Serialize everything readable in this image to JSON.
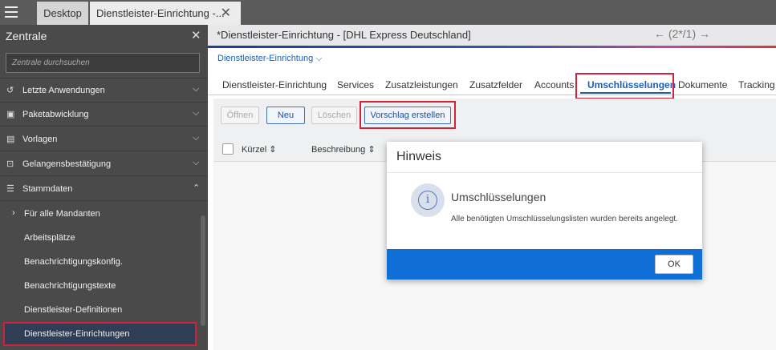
{
  "tabs": {
    "desktop": "Desktop",
    "active": "Dienstleister-Einrichtung -...",
    "close_icon": "✕"
  },
  "sidebar": {
    "title": "Zentrale",
    "search_placeholder": "Zentrale durchsuchen",
    "items": [
      {
        "label": "Letzte Anwendungen",
        "icon": "history-icon",
        "expanded": false
      },
      {
        "label": "Paketabwicklung",
        "icon": "package-icon",
        "expanded": false
      },
      {
        "label": "Vorlagen",
        "icon": "template-icon",
        "expanded": false
      },
      {
        "label": "Gelangensbestätigung",
        "icon": "confirmation-icon",
        "expanded": false
      },
      {
        "label": "Stammdaten",
        "icon": "database-icon",
        "expanded": true
      }
    ],
    "subitems": [
      {
        "label": "Für alle Mandanten",
        "has_arrow": true
      },
      {
        "label": "Arbeitsplätze"
      },
      {
        "label": "Benachrichtigungskonfig."
      },
      {
        "label": "Benachrichtigungstexte"
      },
      {
        "label": "Dienstleister-Definitionen"
      },
      {
        "label": "Dienstleister-Einrichtungen",
        "selected": true
      }
    ]
  },
  "main": {
    "title": "*Dienstleister-Einrichtung - [DHL Express Deutschland]",
    "pager": "(2*/1)",
    "breadcrumb": "Dienstleister-Einrichtung",
    "tabs": [
      "Dienstleister-Einrichtung",
      "Services",
      "Zusatzleistungen",
      "Zusatzfelder",
      "Accounts",
      "Umschlüsselungen",
      "Dokumente",
      "Tracking"
    ],
    "active_tab": "Umschlüsselungen",
    "buttons": {
      "open": "Öffnen",
      "new": "Neu",
      "delete": "Löschen",
      "suggest": "Vorschlag erstellen"
    },
    "columns": [
      "Kürzel",
      "Beschreibung"
    ]
  },
  "dialog": {
    "title": "Hinweis",
    "heading": "Umschlüsselungen",
    "message": "Alle benötigten Umschlüsselungslisten wurden bereits angelegt.",
    "ok": "OK"
  },
  "colors": {
    "accent": "#1d5fb7",
    "highlight": "#d0223a",
    "dialog_footer": "#0f6fd6",
    "sidebar_bg": "#4a4a4a"
  }
}
